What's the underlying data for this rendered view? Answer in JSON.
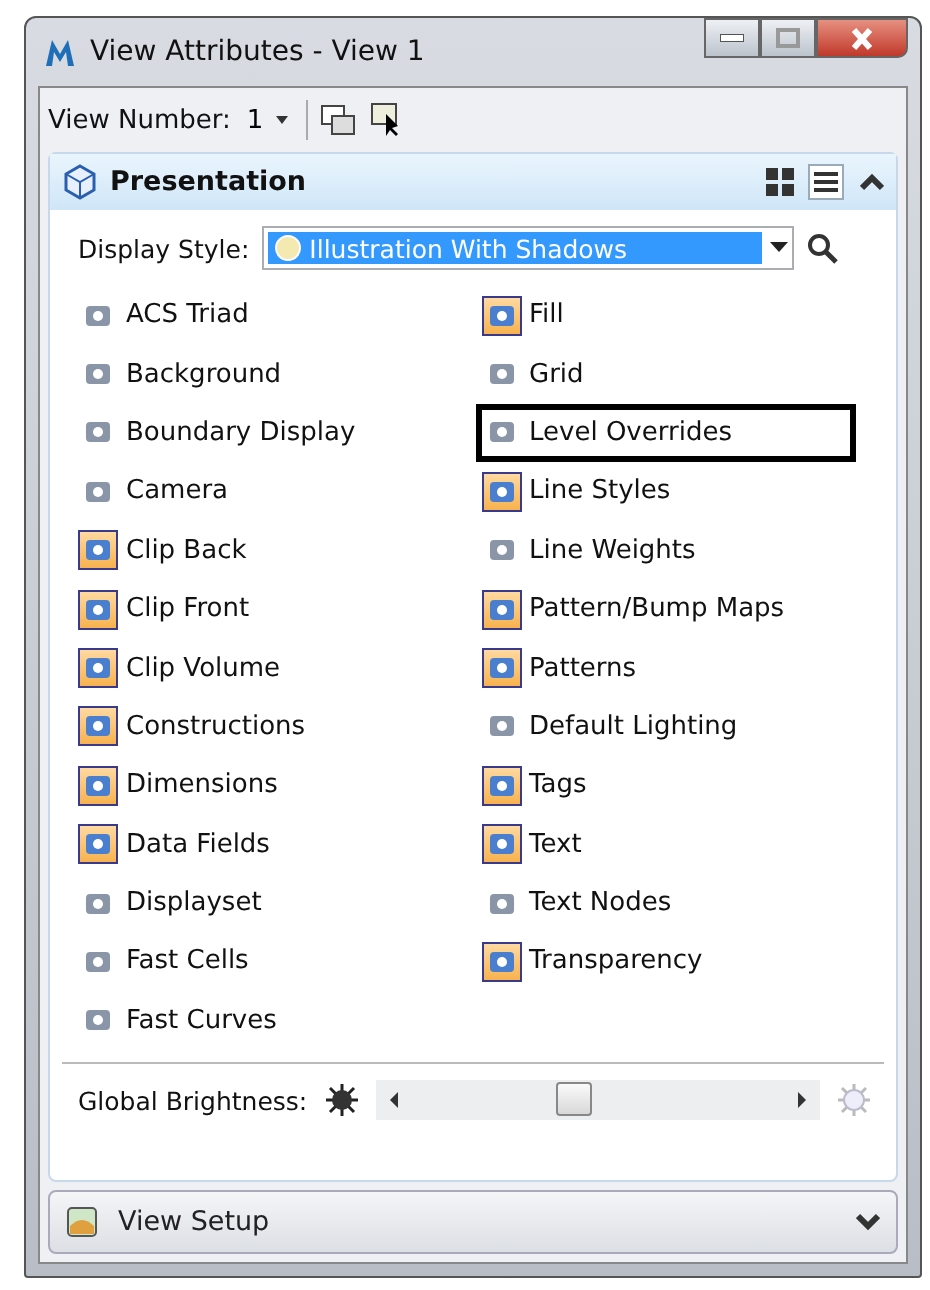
{
  "window": {
    "title": "View Attributes - View 1"
  },
  "toolbar": {
    "label": "View Number:",
    "value": "1"
  },
  "presentation": {
    "title": "Presentation",
    "display_style_label": "Display Style:",
    "display_style": "Illustration With Shadows",
    "left_items": [
      {
        "label": "ACS Triad",
        "on": false,
        "outlined": false
      },
      {
        "label": "Background",
        "on": false,
        "outlined": false
      },
      {
        "label": "Boundary Display",
        "on": false,
        "outlined": false
      },
      {
        "label": "Camera",
        "on": false,
        "outlined": false
      },
      {
        "label": "Clip Back",
        "on": true,
        "outlined": false
      },
      {
        "label": "Clip Front",
        "on": true,
        "outlined": false
      },
      {
        "label": "Clip Volume",
        "on": true,
        "outlined": false
      },
      {
        "label": "Constructions",
        "on": true,
        "outlined": false
      },
      {
        "label": "Dimensions",
        "on": true,
        "outlined": false
      },
      {
        "label": "Data Fields",
        "on": true,
        "outlined": false
      },
      {
        "label": "Displayset",
        "on": false,
        "outlined": false
      },
      {
        "label": "Fast Cells",
        "on": false,
        "outlined": false
      },
      {
        "label": "Fast Curves",
        "on": false,
        "outlined": false
      }
    ],
    "right_items": [
      {
        "label": "Fill",
        "on": true,
        "outlined": false
      },
      {
        "label": "Grid",
        "on": false,
        "outlined": false
      },
      {
        "label": "Level Overrides",
        "on": false,
        "outlined": true
      },
      {
        "label": "Line Styles",
        "on": true,
        "outlined": false
      },
      {
        "label": "Line Weights",
        "on": false,
        "outlined": false
      },
      {
        "label": "Pattern/Bump Maps",
        "on": true,
        "outlined": false
      },
      {
        "label": "Patterns",
        "on": true,
        "outlined": false
      },
      {
        "label": "Default Lighting",
        "on": false,
        "outlined": false
      },
      {
        "label": "Tags",
        "on": true,
        "outlined": false
      },
      {
        "label": "Text",
        "on": true,
        "outlined": false
      },
      {
        "label": "Text Nodes",
        "on": false,
        "outlined": false
      },
      {
        "label": "Transparency",
        "on": true,
        "outlined": false
      }
    ],
    "brightness": {
      "label": "Global Brightness:",
      "level": 0.43
    }
  },
  "view_setup": {
    "title": "View Setup"
  }
}
